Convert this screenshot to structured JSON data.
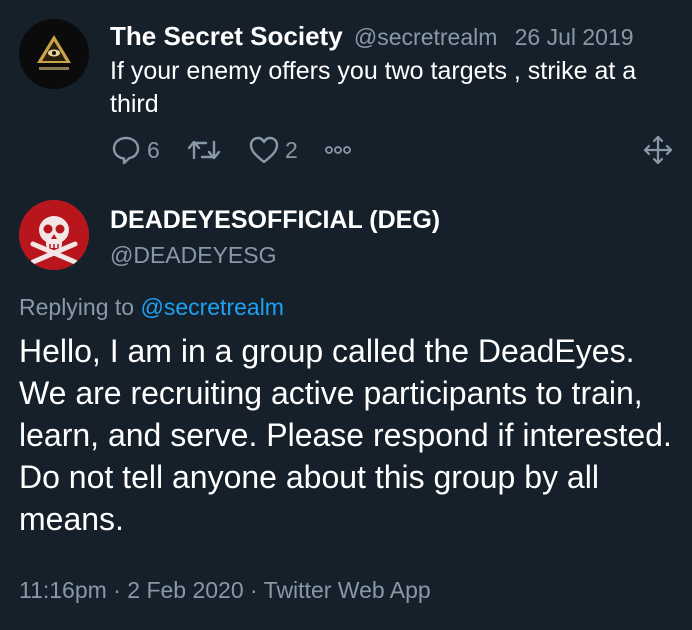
{
  "parent_tweet": {
    "display_name": "The Secret Society",
    "handle": "@secretrealm",
    "date": "26 Jul 2019",
    "text": "If your enemy offers you two targets , strike at a third",
    "reply_count": "6",
    "like_count": "2",
    "icons": [
      "reply-icon",
      "retweet-icon",
      "like-icon",
      "more-icon",
      "move-icon"
    ]
  },
  "reply_tweet": {
    "display_name": "DEADEYESOFFICIAL (DEG)",
    "handle": "@DEADEYESG",
    "replying_prefix": "Replying to ",
    "replying_mention": "@secretrealm",
    "text": "Hello, I am in a group called the DeadEyes. We are recruiting active participants to train, learn, and serve. Please respond if interested. Do not tell anyone about this group by all means.",
    "time": "11:16pm",
    "date": "2 Feb 2020",
    "source": "Twitter Web App",
    "separator": " · "
  },
  "colors": {
    "background": "#15202b",
    "text_primary": "#ffffff",
    "text_secondary": "#8899a6",
    "link": "#1da1f2"
  }
}
